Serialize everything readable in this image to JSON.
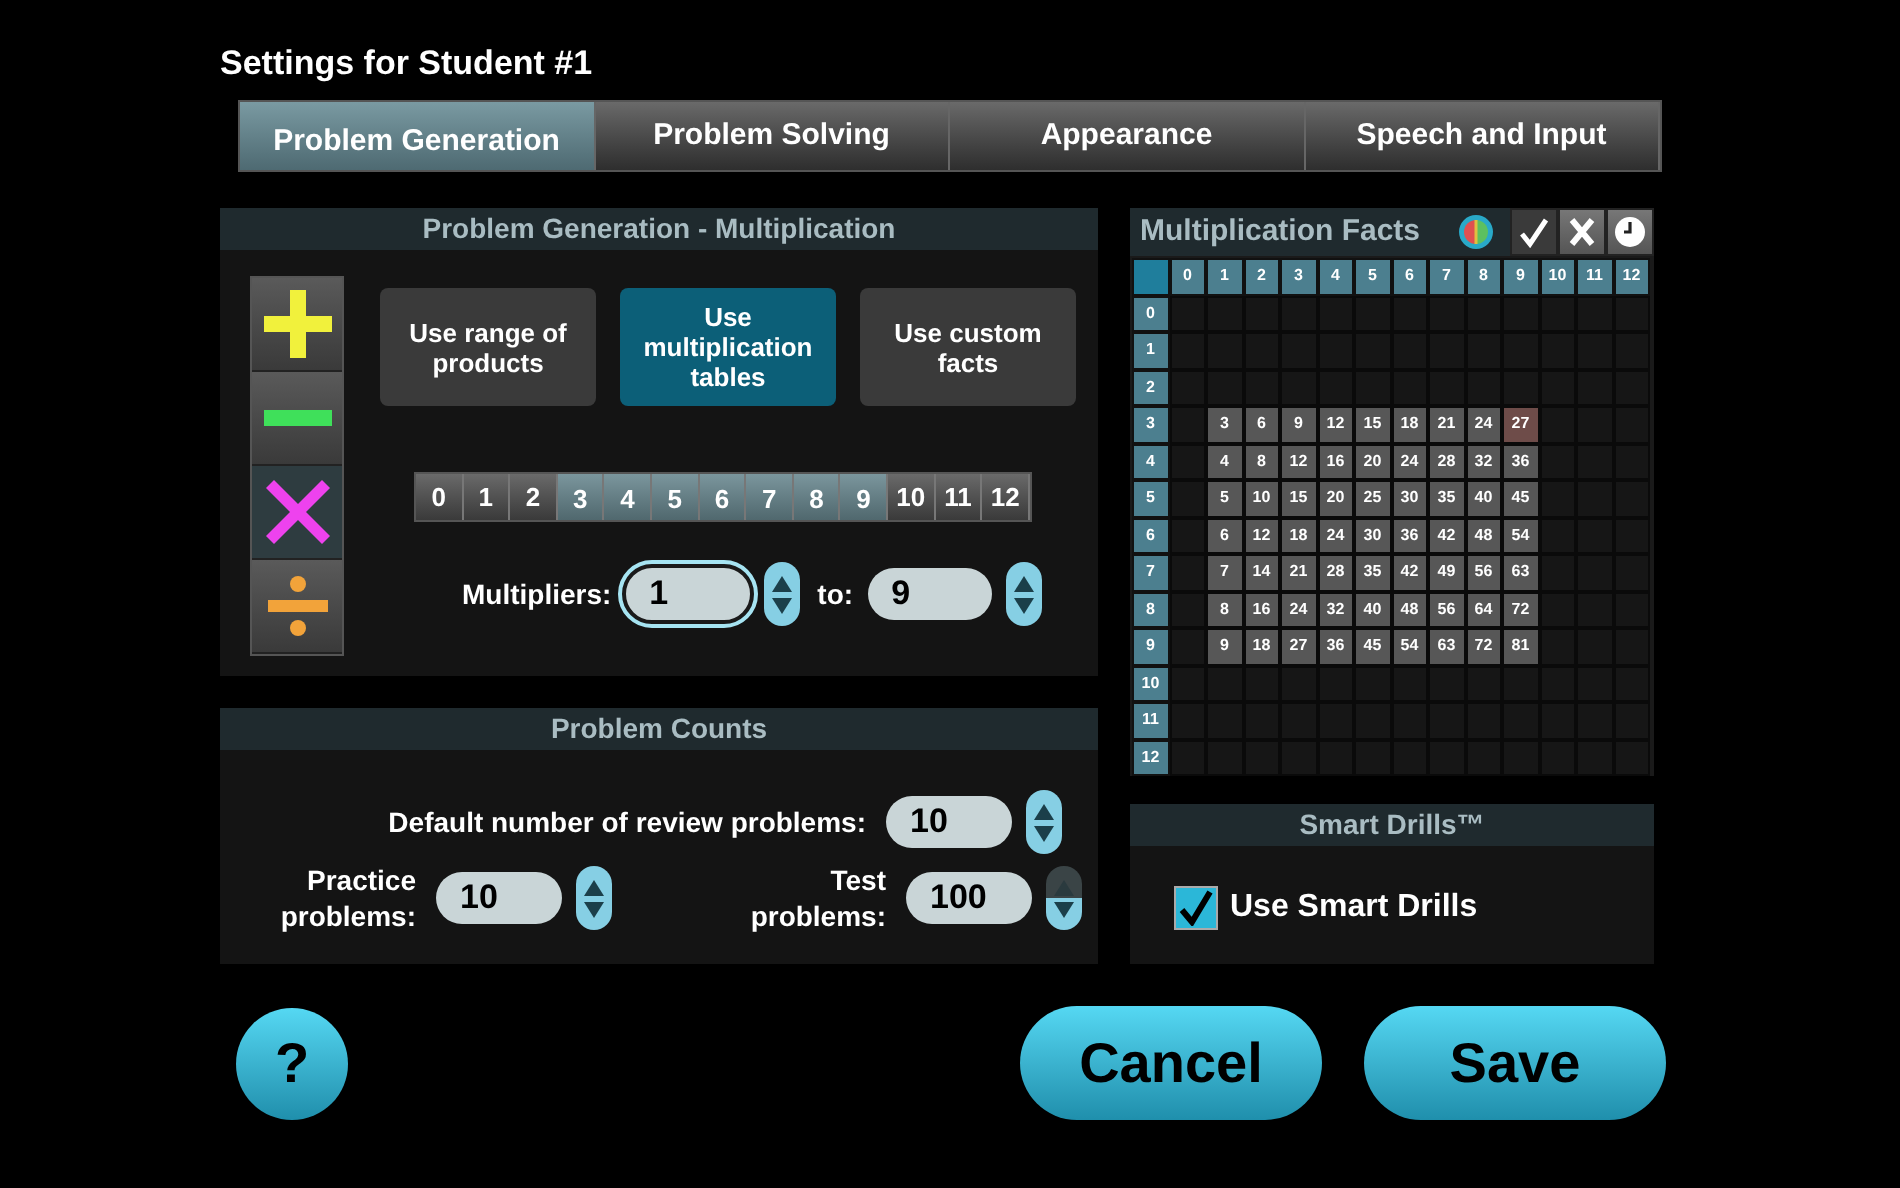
{
  "title": "Settings for Student #1",
  "tabs": [
    {
      "label": "Problem Generation",
      "selected": true
    },
    {
      "label": "Problem Solving",
      "selected": false
    },
    {
      "label": "Appearance",
      "selected": false
    },
    {
      "label": "Speech and Input",
      "selected": false
    }
  ],
  "generation": {
    "header": "Problem Generation - Multiplication",
    "operations": [
      {
        "kind": "add",
        "selected": false
      },
      {
        "kind": "subtract",
        "selected": false
      },
      {
        "kind": "multiply",
        "selected": true
      },
      {
        "kind": "divide",
        "selected": false
      }
    ],
    "modes": [
      {
        "label": "Use range of products",
        "selected": false
      },
      {
        "label": "Use multiplication tables",
        "selected": true
      },
      {
        "label": "Use custom facts",
        "selected": false
      }
    ],
    "tables": [
      {
        "label": "0",
        "selected": false
      },
      {
        "label": "1",
        "selected": false
      },
      {
        "label": "2",
        "selected": false
      },
      {
        "label": "3",
        "selected": true
      },
      {
        "label": "4",
        "selected": true
      },
      {
        "label": "5",
        "selected": true
      },
      {
        "label": "6",
        "selected": true
      },
      {
        "label": "7",
        "selected": true
      },
      {
        "label": "8",
        "selected": true
      },
      {
        "label": "9",
        "selected": true
      },
      {
        "label": "10",
        "selected": false
      },
      {
        "label": "11",
        "selected": false
      },
      {
        "label": "12",
        "selected": false
      }
    ],
    "multipliers": {
      "label": "Multipliers:",
      "from": "1",
      "from_focused": true,
      "to_label": "to:",
      "to": "9"
    }
  },
  "counts": {
    "header": "Problem Counts",
    "review": {
      "label": "Default number of review problems:",
      "value": "10",
      "up_disabled": false
    },
    "practice": {
      "label": "Practice problems:",
      "value": "10",
      "up_disabled": false
    },
    "test": {
      "label": "Test problems:",
      "value": "100",
      "up_disabled": true
    }
  },
  "facts": {
    "title": "Multiplication Facts",
    "filters": [
      {
        "kind": "colors",
        "selected": false
      },
      {
        "kind": "correct",
        "selected": true
      },
      {
        "kind": "wrong",
        "selected": false
      },
      {
        "kind": "timed",
        "selected": false
      }
    ],
    "columns": [
      "0",
      "1",
      "2",
      "3",
      "4",
      "5",
      "6",
      "7",
      "8",
      "9",
      "10",
      "11",
      "12"
    ],
    "rows": [
      {
        "label": "0",
        "cells": [
          {
            "kind": "empty"
          },
          {
            "kind": "empty"
          },
          {
            "kind": "empty"
          },
          {
            "kind": "empty"
          },
          {
            "kind": "empty"
          },
          {
            "kind": "empty"
          },
          {
            "kind": "empty"
          },
          {
            "kind": "empty"
          },
          {
            "kind": "empty"
          },
          {
            "kind": "empty"
          },
          {
            "kind": "empty"
          },
          {
            "kind": "empty"
          },
          {
            "kind": "empty"
          }
        ]
      },
      {
        "label": "1",
        "cells": [
          {
            "kind": "empty"
          },
          {
            "kind": "empty"
          },
          {
            "kind": "empty"
          },
          {
            "kind": "empty"
          },
          {
            "kind": "empty"
          },
          {
            "kind": "empty"
          },
          {
            "kind": "empty"
          },
          {
            "kind": "empty"
          },
          {
            "kind": "empty"
          },
          {
            "kind": "empty"
          },
          {
            "kind": "empty"
          },
          {
            "kind": "empty"
          },
          {
            "kind": "empty"
          }
        ]
      },
      {
        "label": "2",
        "cells": [
          {
            "kind": "empty"
          },
          {
            "kind": "empty"
          },
          {
            "kind": "empty"
          },
          {
            "kind": "empty"
          },
          {
            "kind": "empty"
          },
          {
            "kind": "empty"
          },
          {
            "kind": "empty"
          },
          {
            "kind": "empty"
          },
          {
            "kind": "empty"
          },
          {
            "kind": "empty"
          },
          {
            "kind": "empty"
          },
          {
            "kind": "empty"
          },
          {
            "kind": "empty"
          }
        ]
      },
      {
        "label": "3",
        "cells": [
          {
            "kind": "empty"
          },
          {
            "kind": "fact",
            "value": "3"
          },
          {
            "kind": "fact",
            "value": "6"
          },
          {
            "kind": "fact",
            "value": "9"
          },
          {
            "kind": "fact",
            "value": "12"
          },
          {
            "kind": "fact",
            "value": "15"
          },
          {
            "kind": "fact",
            "value": "18"
          },
          {
            "kind": "fact",
            "value": "21"
          },
          {
            "kind": "fact",
            "value": "24"
          },
          {
            "kind": "missed",
            "value": "27"
          },
          {
            "kind": "empty"
          },
          {
            "kind": "empty"
          },
          {
            "kind": "empty"
          }
        ]
      },
      {
        "label": "4",
        "cells": [
          {
            "kind": "empty"
          },
          {
            "kind": "fact",
            "value": "4"
          },
          {
            "kind": "fact",
            "value": "8"
          },
          {
            "kind": "fact",
            "value": "12"
          },
          {
            "kind": "fact",
            "value": "16"
          },
          {
            "kind": "fact",
            "value": "20"
          },
          {
            "kind": "fact",
            "value": "24"
          },
          {
            "kind": "fact",
            "value": "28"
          },
          {
            "kind": "fact",
            "value": "32"
          },
          {
            "kind": "fact",
            "value": "36"
          },
          {
            "kind": "empty"
          },
          {
            "kind": "empty"
          },
          {
            "kind": "empty"
          }
        ]
      },
      {
        "label": "5",
        "cells": [
          {
            "kind": "empty"
          },
          {
            "kind": "fact",
            "value": "5"
          },
          {
            "kind": "fact",
            "value": "10"
          },
          {
            "kind": "fact",
            "value": "15"
          },
          {
            "kind": "fact",
            "value": "20"
          },
          {
            "kind": "fact",
            "value": "25"
          },
          {
            "kind": "fact",
            "value": "30"
          },
          {
            "kind": "fact",
            "value": "35"
          },
          {
            "kind": "fact",
            "value": "40"
          },
          {
            "kind": "fact",
            "value": "45"
          },
          {
            "kind": "empty"
          },
          {
            "kind": "empty"
          },
          {
            "kind": "empty"
          }
        ]
      },
      {
        "label": "6",
        "cells": [
          {
            "kind": "empty"
          },
          {
            "kind": "fact",
            "value": "6"
          },
          {
            "kind": "fact",
            "value": "12"
          },
          {
            "kind": "fact",
            "value": "18"
          },
          {
            "kind": "fact",
            "value": "24"
          },
          {
            "kind": "fact",
            "value": "30"
          },
          {
            "kind": "fact",
            "value": "36"
          },
          {
            "kind": "fact",
            "value": "42"
          },
          {
            "kind": "fact",
            "value": "48"
          },
          {
            "kind": "fact",
            "value": "54"
          },
          {
            "kind": "empty"
          },
          {
            "kind": "empty"
          },
          {
            "kind": "empty"
          }
        ]
      },
      {
        "label": "7",
        "cells": [
          {
            "kind": "empty"
          },
          {
            "kind": "fact",
            "value": "7"
          },
          {
            "kind": "fact",
            "value": "14"
          },
          {
            "kind": "fact",
            "value": "21"
          },
          {
            "kind": "fact",
            "value": "28"
          },
          {
            "kind": "fact",
            "value": "35"
          },
          {
            "kind": "fact",
            "value": "42"
          },
          {
            "kind": "fact",
            "value": "49"
          },
          {
            "kind": "fact",
            "value": "56"
          },
          {
            "kind": "fact",
            "value": "63"
          },
          {
            "kind": "empty"
          },
          {
            "kind": "empty"
          },
          {
            "kind": "empty"
          }
        ]
      },
      {
        "label": "8",
        "cells": [
          {
            "kind": "empty"
          },
          {
            "kind": "fact",
            "value": "8"
          },
          {
            "kind": "fact",
            "value": "16"
          },
          {
            "kind": "fact",
            "value": "24"
          },
          {
            "kind": "fact",
            "value": "32"
          },
          {
            "kind": "fact",
            "value": "40"
          },
          {
            "kind": "fact",
            "value": "48"
          },
          {
            "kind": "fact",
            "value": "56"
          },
          {
            "kind": "fact",
            "value": "64"
          },
          {
            "kind": "fact",
            "value": "72"
          },
          {
            "kind": "empty"
          },
          {
            "kind": "empty"
          },
          {
            "kind": "empty"
          }
        ]
      },
      {
        "label": "9",
        "cells": [
          {
            "kind": "empty"
          },
          {
            "kind": "fact",
            "value": "9"
          },
          {
            "kind": "fact",
            "value": "18"
          },
          {
            "kind": "fact",
            "value": "27"
          },
          {
            "kind": "fact",
            "value": "36"
          },
          {
            "kind": "fact",
            "value": "45"
          },
          {
            "kind": "fact",
            "value": "54"
          },
          {
            "kind": "fact",
            "value": "63"
          },
          {
            "kind": "fact",
            "value": "72"
          },
          {
            "kind": "fact",
            "value": "81"
          },
          {
            "kind": "empty"
          },
          {
            "kind": "empty"
          },
          {
            "kind": "empty"
          }
        ]
      },
      {
        "label": "10",
        "cells": [
          {
            "kind": "empty"
          },
          {
            "kind": "empty"
          },
          {
            "kind": "empty"
          },
          {
            "kind": "empty"
          },
          {
            "kind": "empty"
          },
          {
            "kind": "empty"
          },
          {
            "kind": "empty"
          },
          {
            "kind": "empty"
          },
          {
            "kind": "empty"
          },
          {
            "kind": "empty"
          },
          {
            "kind": "empty"
          },
          {
            "kind": "empty"
          },
          {
            "kind": "empty"
          }
        ]
      },
      {
        "label": "11",
        "cells": [
          {
            "kind": "empty"
          },
          {
            "kind": "empty"
          },
          {
            "kind": "empty"
          },
          {
            "kind": "empty"
          },
          {
            "kind": "empty"
          },
          {
            "kind": "empty"
          },
          {
            "kind": "empty"
          },
          {
            "kind": "empty"
          },
          {
            "kind": "empty"
          },
          {
            "kind": "empty"
          },
          {
            "kind": "empty"
          },
          {
            "kind": "empty"
          },
          {
            "kind": "empty"
          }
        ]
      },
      {
        "label": "12",
        "cells": [
          {
            "kind": "empty"
          },
          {
            "kind": "empty"
          },
          {
            "kind": "empty"
          },
          {
            "kind": "empty"
          },
          {
            "kind": "empty"
          },
          {
            "kind": "empty"
          },
          {
            "kind": "empty"
          },
          {
            "kind": "empty"
          },
          {
            "kind": "empty"
          },
          {
            "kind": "empty"
          },
          {
            "kind": "empty"
          },
          {
            "kind": "empty"
          },
          {
            "kind": "empty"
          }
        ]
      }
    ]
  },
  "smart_drills": {
    "header": "Smart Drills™",
    "label": "Use Smart Drills",
    "checked": true
  },
  "buttons": {
    "help": "?",
    "cancel": "Cancel",
    "save": "Save"
  }
}
